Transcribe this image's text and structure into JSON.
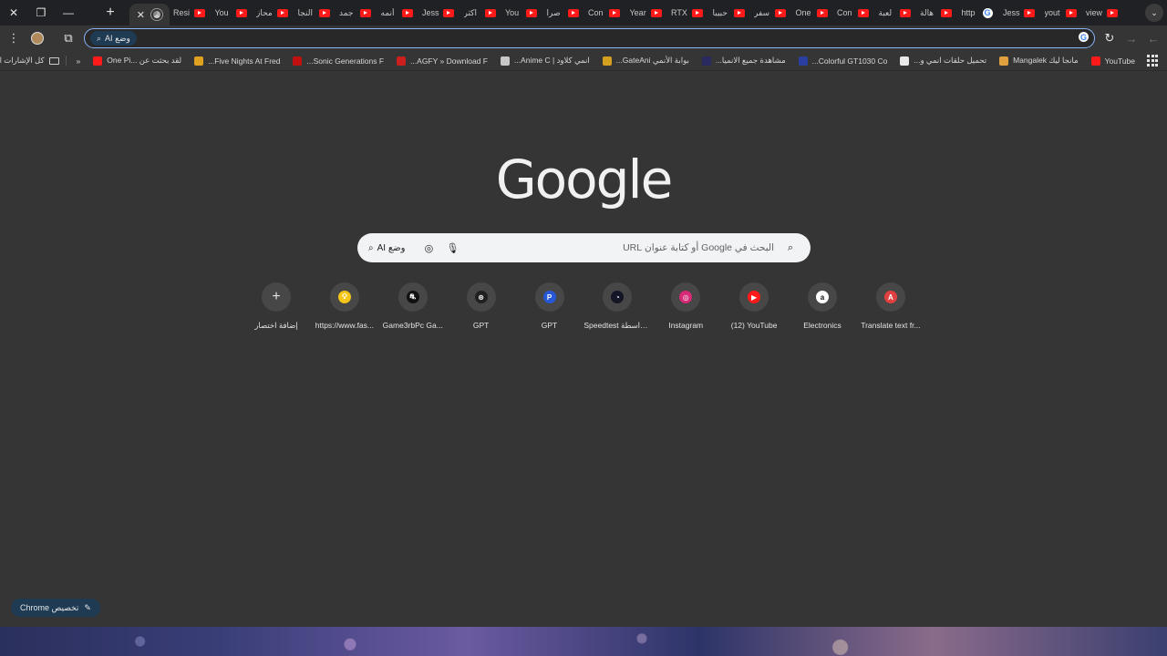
{
  "tabstrip": {
    "tabs": [
      {
        "label": "Resi",
        "icon": "youtube-icon"
      },
      {
        "label": "You",
        "icon": "youtube-icon"
      },
      {
        "label": "محاز",
        "icon": "youtube-icon"
      },
      {
        "label": "النجا",
        "icon": "youtube-icon"
      },
      {
        "label": "جمد",
        "icon": "youtube-icon"
      },
      {
        "label": "أنمه",
        "icon": "youtube-icon"
      },
      {
        "label": "Jess",
        "icon": "youtube-icon"
      },
      {
        "label": "اكثر",
        "icon": "youtube-icon"
      },
      {
        "label": "You",
        "icon": "youtube-icon"
      },
      {
        "label": "صرا",
        "icon": "youtube-icon"
      },
      {
        "label": "Con",
        "icon": "youtube-icon"
      },
      {
        "label": "Year",
        "icon": "youtube-icon"
      },
      {
        "label": "RTX",
        "icon": "youtube-icon"
      },
      {
        "label": "حبيبا",
        "icon": "youtube-icon"
      },
      {
        "label": "سفر",
        "icon": "youtube-icon"
      },
      {
        "label": "One",
        "icon": "youtube-icon"
      },
      {
        "label": "Con",
        "icon": "youtube-icon"
      },
      {
        "label": "لعبة",
        "icon": "youtube-icon"
      },
      {
        "label": "هالة",
        "icon": "youtube-icon"
      },
      {
        "label": "http",
        "icon": "google-icon"
      },
      {
        "label": "Jess",
        "icon": "youtube-icon"
      },
      {
        "label": "yout",
        "icon": "youtube-icon"
      },
      {
        "label": "view",
        "icon": "youtube-icon"
      }
    ]
  },
  "omnibox": {
    "ai_mode_label": "وضع AI",
    "value": ""
  },
  "bookmarks": {
    "items": [
      {
        "label": "YouTube",
        "color": "#ff1a1a"
      },
      {
        "label": "مانجا ليك Mangalek",
        "color": "#e0a040"
      },
      {
        "label": "تحميل حلقات انمي و...",
        "color": "#e8e8e8"
      },
      {
        "label": "Colorful GT1030 Co...",
        "color": "#2a3fa0"
      },
      {
        "label": "مشاهدة جميع الانميا...",
        "color": "#2a2a60"
      },
      {
        "label": "بوابة الأنمي GateAni...",
        "color": "#d4a020"
      },
      {
        "label": "انمي كلاود | Anime C...",
        "color": "#c8c8c8"
      },
      {
        "label": "AGFY » Download F...",
        "color": "#cc2020"
      },
      {
        "label": "Sonic Generations F...",
        "color": "#c01010"
      },
      {
        "label": "Five Nights At Fred...",
        "color": "#e0a020"
      },
      {
        "label": "لقد بحثت عن ...One Pi",
        "color": "#ff1a1a"
      }
    ],
    "all_bookmarks": "كل الإشارات المرجعية"
  },
  "logo": "Google",
  "search": {
    "placeholder": "البحث في Google أو كتابة عنوان URL",
    "ai_mode_label": "وضع AI"
  },
  "shortcuts": [
    {
      "label": "إضافة اختصار",
      "icon": "plus-icon",
      "color": "#474747"
    },
    {
      "label": "https://www.fas...",
      "icon": "bulb-icon",
      "color": "#f5c518"
    },
    {
      "label": "Game3rbPc Ga...",
      "icon": "game-icon",
      "color": "#111111"
    },
    {
      "label": "GPT",
      "icon": "openai-icon",
      "color": "#202020"
    },
    {
      "label": "GPT",
      "icon": "p-icon",
      "color": "#2557d6"
    },
    {
      "label": "Speedtest بواسطة...",
      "icon": "speedometer-icon",
      "color": "#141526"
    },
    {
      "label": "Instagram",
      "icon": "instagram-icon",
      "color": "#d62976"
    },
    {
      "label": "(12) YouTube",
      "icon": "youtube-icon",
      "color": "#ff1a1a"
    },
    {
      "label": "Electronics",
      "icon": "amazon-icon",
      "color": "#ffffff"
    },
    {
      "label": "Translate text fr...",
      "icon": "translate-icon",
      "color": "#e04040"
    }
  ],
  "customize": {
    "label": "تخصيص Chrome"
  }
}
